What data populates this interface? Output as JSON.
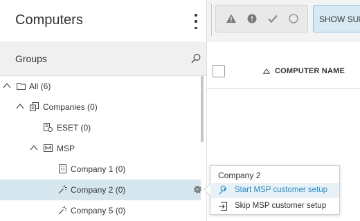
{
  "left_panel": {
    "title": "Computers",
    "groups_label": "Groups"
  },
  "tree": [
    {
      "label": "All (6)",
      "icon": "folder-icon",
      "chevron": "expanded"
    },
    {
      "label": "Companies (0)",
      "icon": "companies-icon",
      "chevron": "expanded"
    },
    {
      "label": "ESET (0)",
      "icon": "company-icon"
    },
    {
      "label": "MSP",
      "icon": "msp-icon",
      "chevron": "expanded"
    },
    {
      "label": "Company 1 (0)",
      "icon": "building-icon"
    },
    {
      "label": "Company 2 (0)",
      "icon": "wand-icon",
      "selected": true
    },
    {
      "label": "Company 5 (0)",
      "icon": "wand-icon"
    }
  ],
  "toolbar": {
    "show_sub_label": "SHOW SUB"
  },
  "table": {
    "column_header": "COMPUTER NAME"
  },
  "context_menu": {
    "title": "Company 2",
    "items": [
      {
        "label": "Start MSP customer setup",
        "icon": "wrench-icon",
        "color": "#2a8bc0"
      },
      {
        "label": "Skip MSP customer setup",
        "icon": "skip-icon",
        "color": "#333333"
      }
    ]
  },
  "colors": {
    "selected_row": "#d5e6ef",
    "accent": "#2a8bc0",
    "toggle_active_bg": "#d7eaf3"
  }
}
